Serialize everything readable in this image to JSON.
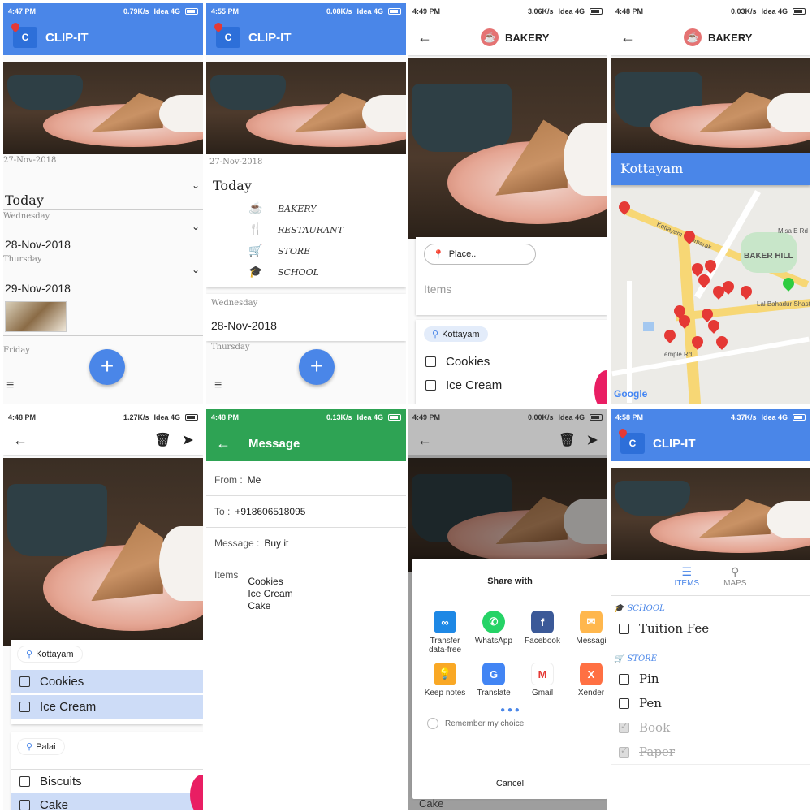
{
  "screens": {
    "s1": {
      "time": "4:47 PM",
      "speed": "0.79K/s",
      "carrier": "Idea 4G",
      "title": "CLIP-IT",
      "date_top": "27-Nov-2018",
      "today": "Today",
      "day2": "Wednesday",
      "date2": "28-Nov-2018",
      "day3": "Thursday",
      "date3": "29-Nov-2018",
      "day4": "Friday"
    },
    "s2": {
      "time": "4:55 PM",
      "speed": "0.08K/s",
      "carrier": "Idea 4G",
      "title": "CLIP-IT",
      "date_top": "27-Nov-2018",
      "today": "Today",
      "categories": [
        {
          "icon": "☕",
          "label": "BAKERY"
        },
        {
          "icon": "🍴",
          "label": "RESTAURANT"
        },
        {
          "icon": "🛒",
          "label": "STORE"
        },
        {
          "icon": "🎓",
          "label": "SCHOOL"
        }
      ],
      "day2": "Wednesday",
      "date2": "28-Nov-2018",
      "day3": "Thursday"
    },
    "s3": {
      "time": "4:49 PM",
      "speed": "3.06K/s",
      "carrier": "Idea 4G",
      "title": "BAKERY",
      "place_placeholder": "Place..",
      "items_placeholder": "Items",
      "chip": "Kottayam",
      "items": [
        "Cookies",
        "Ice Cream"
      ]
    },
    "s4": {
      "time": "4:48 PM",
      "speed": "0.03K/s",
      "carrier": "Idea 4G",
      "title": "BAKERY",
      "location": "Kottayam",
      "map_labels": {
        "hill": "BAKER HILL",
        "road": "Lal Bahadur Shast",
        "misa": "Misa E Rd",
        "brand": "Google",
        "kottayam_kumaral": "Kottayam - Kumarak",
        "temple": "Temple Rd"
      }
    },
    "s5": {
      "time": "4:48 PM",
      "speed": "1.27K/s",
      "carrier": "Idea 4G",
      "chip1": "Kottayam",
      "items1": [
        "Cookies",
        "Ice Cream"
      ],
      "chip2": "Palai",
      "items2": [
        "Biscuits",
        "Cake"
      ]
    },
    "s6": {
      "time": "4:48 PM",
      "speed": "0.13K/s",
      "carrier": "Idea 4G",
      "title": "Message",
      "from_label": "From :",
      "from_val": "Me",
      "to_label": "To :",
      "to_val": "+918606518095",
      "msg_label": "Message :",
      "msg_val": "Buy it",
      "items_label": "Items",
      "items": [
        "Cookies",
        "Ice Cream",
        "Cake"
      ]
    },
    "s7": {
      "time": "4:49 PM",
      "speed": "0.00K/s",
      "carrier": "Idea 4G",
      "share_title": "Share with",
      "apps": [
        {
          "label": "Transfer data-free",
          "color": "#1e88e5",
          "glyph": "∞"
        },
        {
          "label": "WhatsApp",
          "color": "#25d366",
          "glyph": "✆"
        },
        {
          "label": "Facebook",
          "color": "#3b5998",
          "glyph": "f"
        },
        {
          "label": "Messagi",
          "color": "#ffb74d",
          "glyph": "✉"
        },
        {
          "label": "Keep notes",
          "color": "#f9a825",
          "glyph": "💡"
        },
        {
          "label": "Translate",
          "color": "#4285f4",
          "glyph": "G"
        },
        {
          "label": "Gmail",
          "color": "#e53935",
          "glyph": "M"
        },
        {
          "label": "Xender",
          "color": "#ff7043",
          "glyph": "X"
        }
      ],
      "remember": "Remember my choice",
      "cancel": "Cancel",
      "behind_item": "Cake"
    },
    "s8": {
      "time": "4:58 PM",
      "speed": "4.37K/s",
      "carrier": "Idea 4G",
      "title": "CLIP-IT",
      "tab_items": "ITEMS",
      "tab_maps": "MAPS",
      "group1": "SCHOOL",
      "g1_items": [
        "Tuition Fee"
      ],
      "group2": "STORE",
      "g2_items": [
        "Pin",
        "Pen"
      ],
      "g2_done": [
        "Book",
        "Paper"
      ]
    }
  },
  "colors": {
    "primary": "#4a86e8",
    "green": "#2ea354",
    "pin": "#e53935",
    "pin_green": "#2ecc40"
  }
}
